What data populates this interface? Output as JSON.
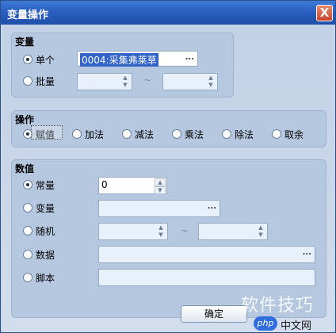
{
  "window": {
    "title": "变量操作",
    "close_label": "X"
  },
  "variable_group": {
    "title": "变量",
    "single": {
      "label": "单个",
      "checked": true,
      "value": "0004:采集弗莱草",
      "button": "..."
    },
    "batch": {
      "label": "批量",
      "checked": false,
      "from_value": "",
      "to_value": "",
      "separator": "~"
    }
  },
  "operation_group": {
    "title": "操作",
    "options": [
      {
        "label": "赋值",
        "checked": true
      },
      {
        "label": "加法",
        "checked": false
      },
      {
        "label": "减法",
        "checked": false
      },
      {
        "label": "乘法",
        "checked": false
      },
      {
        "label": "除法",
        "checked": false
      },
      {
        "label": "取余",
        "checked": false
      }
    ]
  },
  "value_group": {
    "title": "数值",
    "constant": {
      "label": "常量",
      "checked": true,
      "value": "0"
    },
    "variable": {
      "label": "变量",
      "checked": false,
      "value": "",
      "button": "..."
    },
    "random": {
      "label": "随机",
      "checked": false,
      "from_value": "",
      "to_value": "",
      "separator": "~"
    },
    "data": {
      "label": "数据",
      "checked": false,
      "value": "",
      "button": "..."
    },
    "script": {
      "label": "脚本",
      "checked": false,
      "value": ""
    }
  },
  "buttons": {
    "ok_label": "确定"
  },
  "watermark": {
    "text": "软件技巧",
    "logo": "php",
    "site": "中文网"
  },
  "icons": {
    "spin_up": "spin-up-arrow-icon",
    "spin_down": "spin-down-arrow-icon",
    "close": "close-icon"
  },
  "colors": {
    "titlebar": "#2a5fc0",
    "selection": "#3163c8",
    "group_bg": "#b6c8e0"
  }
}
